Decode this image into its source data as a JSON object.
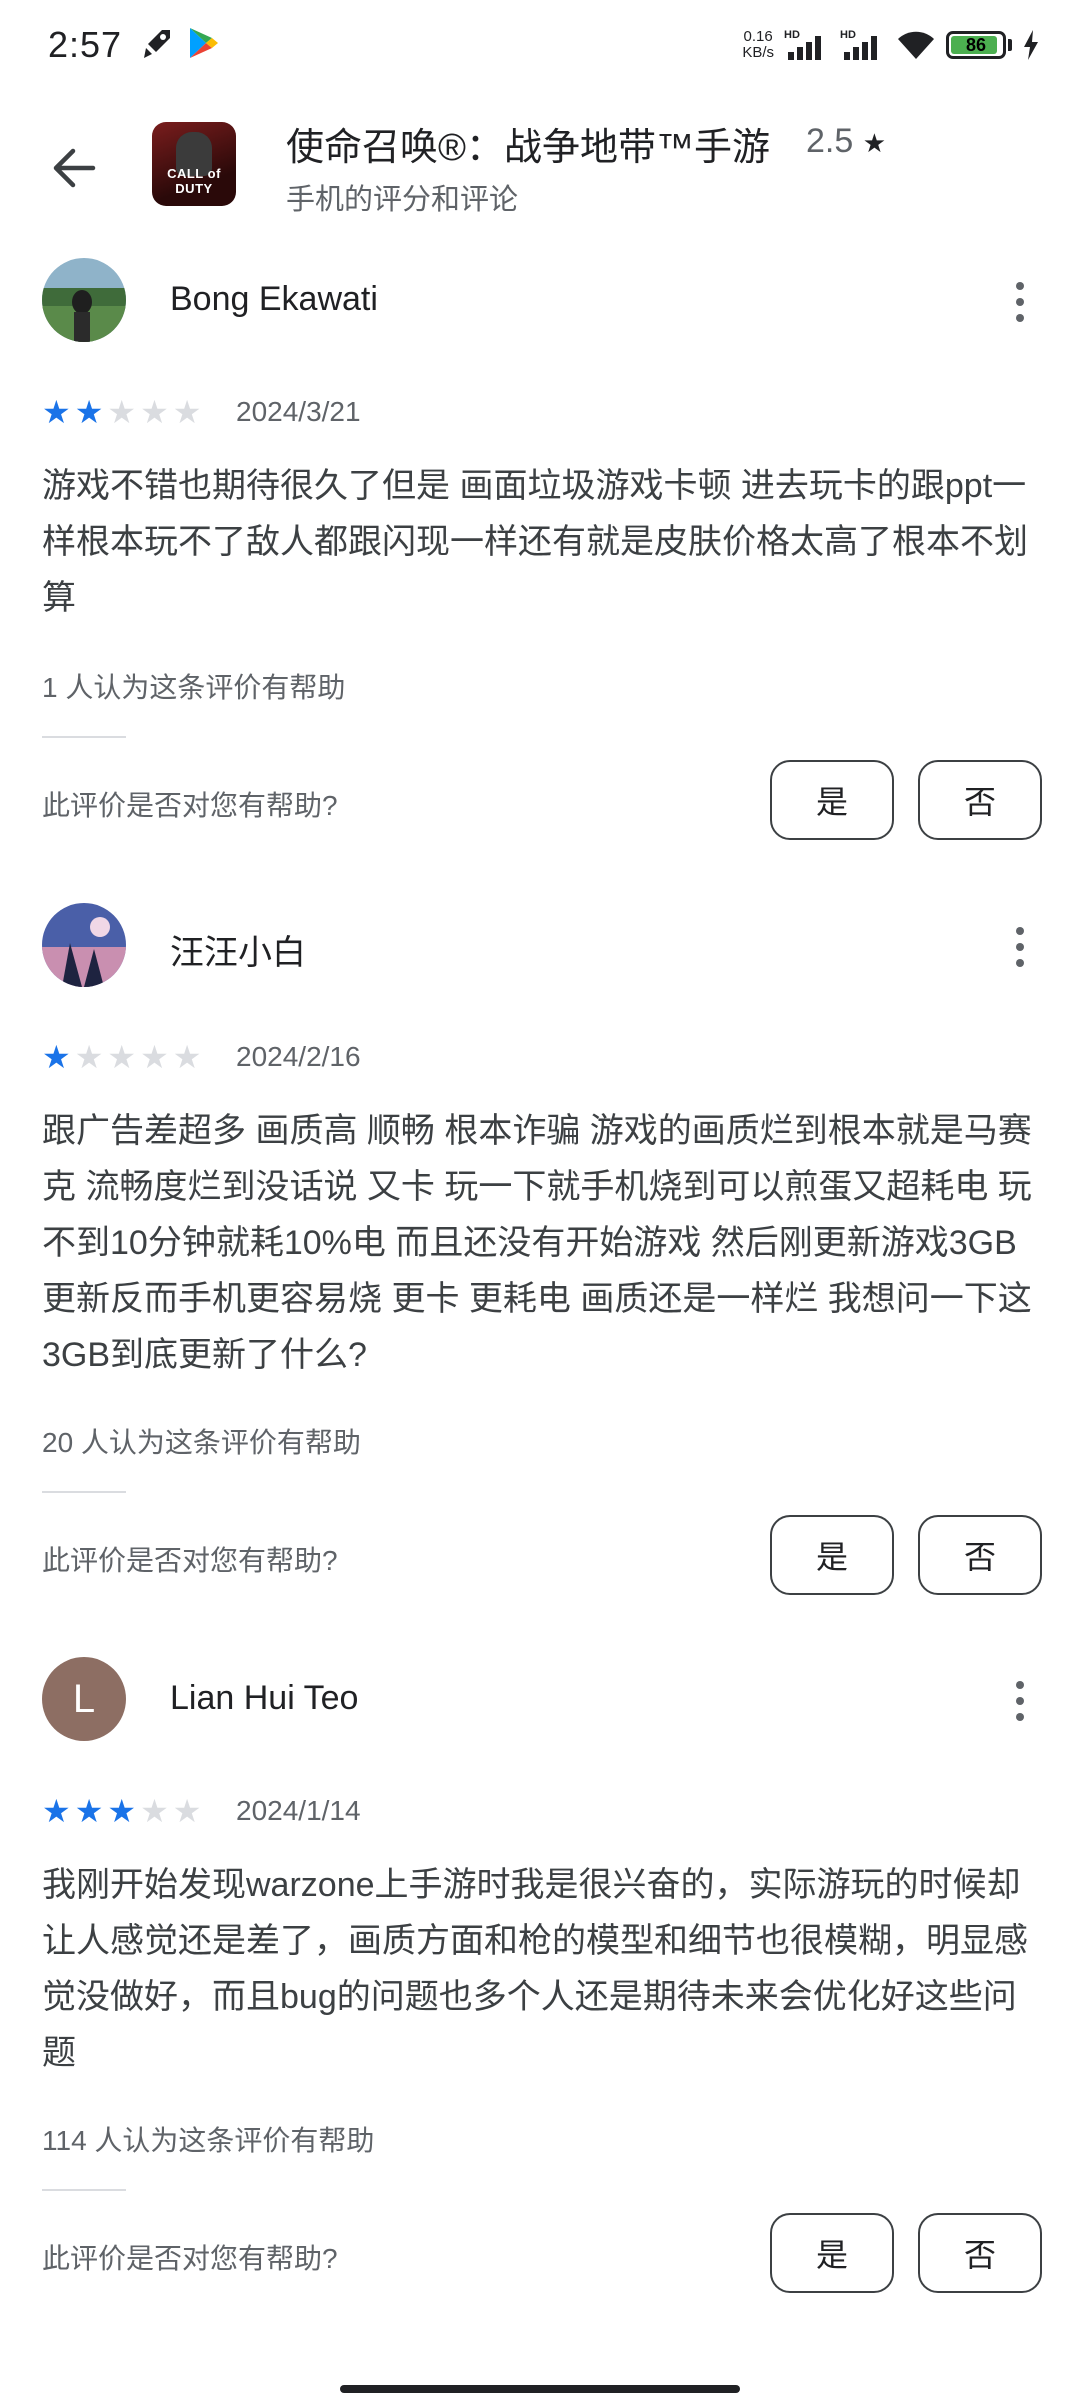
{
  "status_bar": {
    "time": "2:57",
    "net_speed_value": "0.16",
    "net_speed_unit": "KB/s",
    "signal_label": "HD",
    "battery": "86",
    "battery_level": 0.86,
    "icons": [
      "rocket-icon",
      "play-store-icon",
      "signal-icon",
      "signal-icon",
      "wifi-icon",
      "battery-icon",
      "charging-icon"
    ]
  },
  "header": {
    "back_icon": "arrow-left-icon",
    "app_title": "使命召唤®：战争地带™手游",
    "app_rating": "2.5",
    "rating_star": "★",
    "subtitle": "手机的评分和评论",
    "app_icon_label": "CALL of DUTY"
  },
  "reviews": [
    {
      "name": "Bong Ekawati",
      "avatar": "photo",
      "rating": 2,
      "date": "2024/3/21",
      "text": "游戏不错也期待很久了但是 画面垃圾游戏卡顿 进去玩卡的跟ppt一样根本玩不了敌人都跟闪现一样还有就是皮肤价格太高了根本不划算",
      "helpful_count": "1 人认为这条评价有帮助",
      "helpful_question": "此评价是否对您有帮助?",
      "yes": "是",
      "no": "否"
    },
    {
      "name": "汪汪小白",
      "avatar": "photo",
      "rating": 1,
      "date": "2024/2/16",
      "text": "跟广告差超多 画质高 顺畅 根本诈骗 游戏的画质烂到根本就是马赛克 流畅度烂到没话说 又卡 玩一下就手机烧到可以煎蛋又超耗电 玩不到10分钟就耗10%电 而且还没有开始游戏 然后刚更新游戏3GB 更新反而手机更容易烧 更卡 更耗电 画质还是一样烂 我想问一下这3GB到底更新了什么?",
      "helpful_count": "20 人认为这条评价有帮助",
      "helpful_question": "此评价是否对您有帮助?",
      "yes": "是",
      "no": "否"
    },
    {
      "name": "Lian Hui Teo",
      "avatar": "L",
      "rating": 3,
      "date": "2024/1/14",
      "text": "我刚开始发现warzone上手游时我是很兴奋的，实际游玩的时候却让人感觉还是差了，画质方面和枪的模型和细节也很模糊，明显感觉没做好，而且bug的问题也多个人还是期待未来会优化好这些问题",
      "helpful_count": "114 人认为这条评价有帮助",
      "helpful_question": "此评价是否对您有帮助?",
      "yes": "是",
      "no": "否"
    }
  ],
  "colors": {
    "star_active": "#1a73e8",
    "star_inactive": "#dadce0",
    "avatar_letter_bg": "#8d6e63"
  }
}
